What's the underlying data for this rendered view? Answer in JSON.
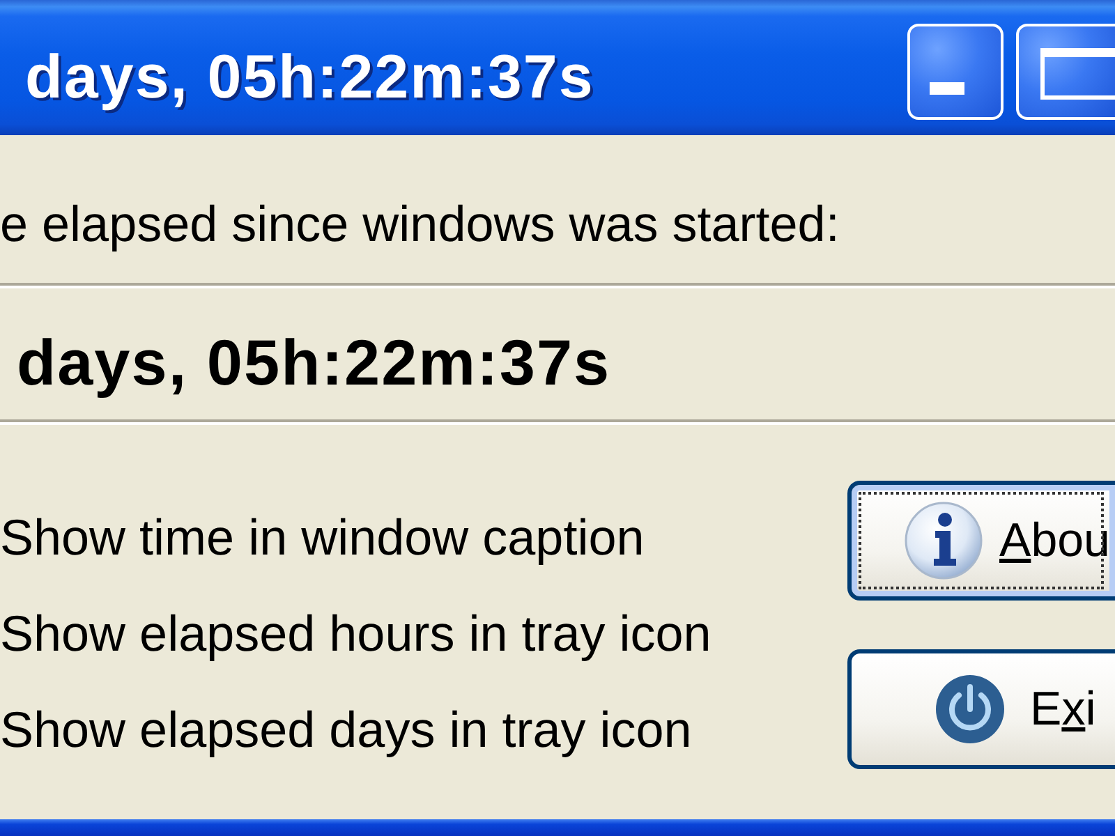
{
  "window": {
    "title": "days, 05h:22m:37s",
    "title_buttons": [
      {
        "kind": "minimize"
      },
      {
        "kind": "maximize"
      }
    ]
  },
  "uptime": {
    "label": "e elapsed since windows was started:",
    "value": "days, 05h:22m:37s"
  },
  "options": [
    {
      "label": "Show time in window caption"
    },
    {
      "label": "Show elapsed hours in tray icon"
    },
    {
      "label": "Show elapsed days in tray icon"
    }
  ],
  "buttons": [
    {
      "kind": "about",
      "focused": true,
      "label": {
        "key": "A",
        "after": "bou"
      }
    },
    {
      "kind": "exit",
      "focused": false,
      "label": {
        "before": "E",
        "key": "x",
        "after": "i"
      }
    }
  ]
}
